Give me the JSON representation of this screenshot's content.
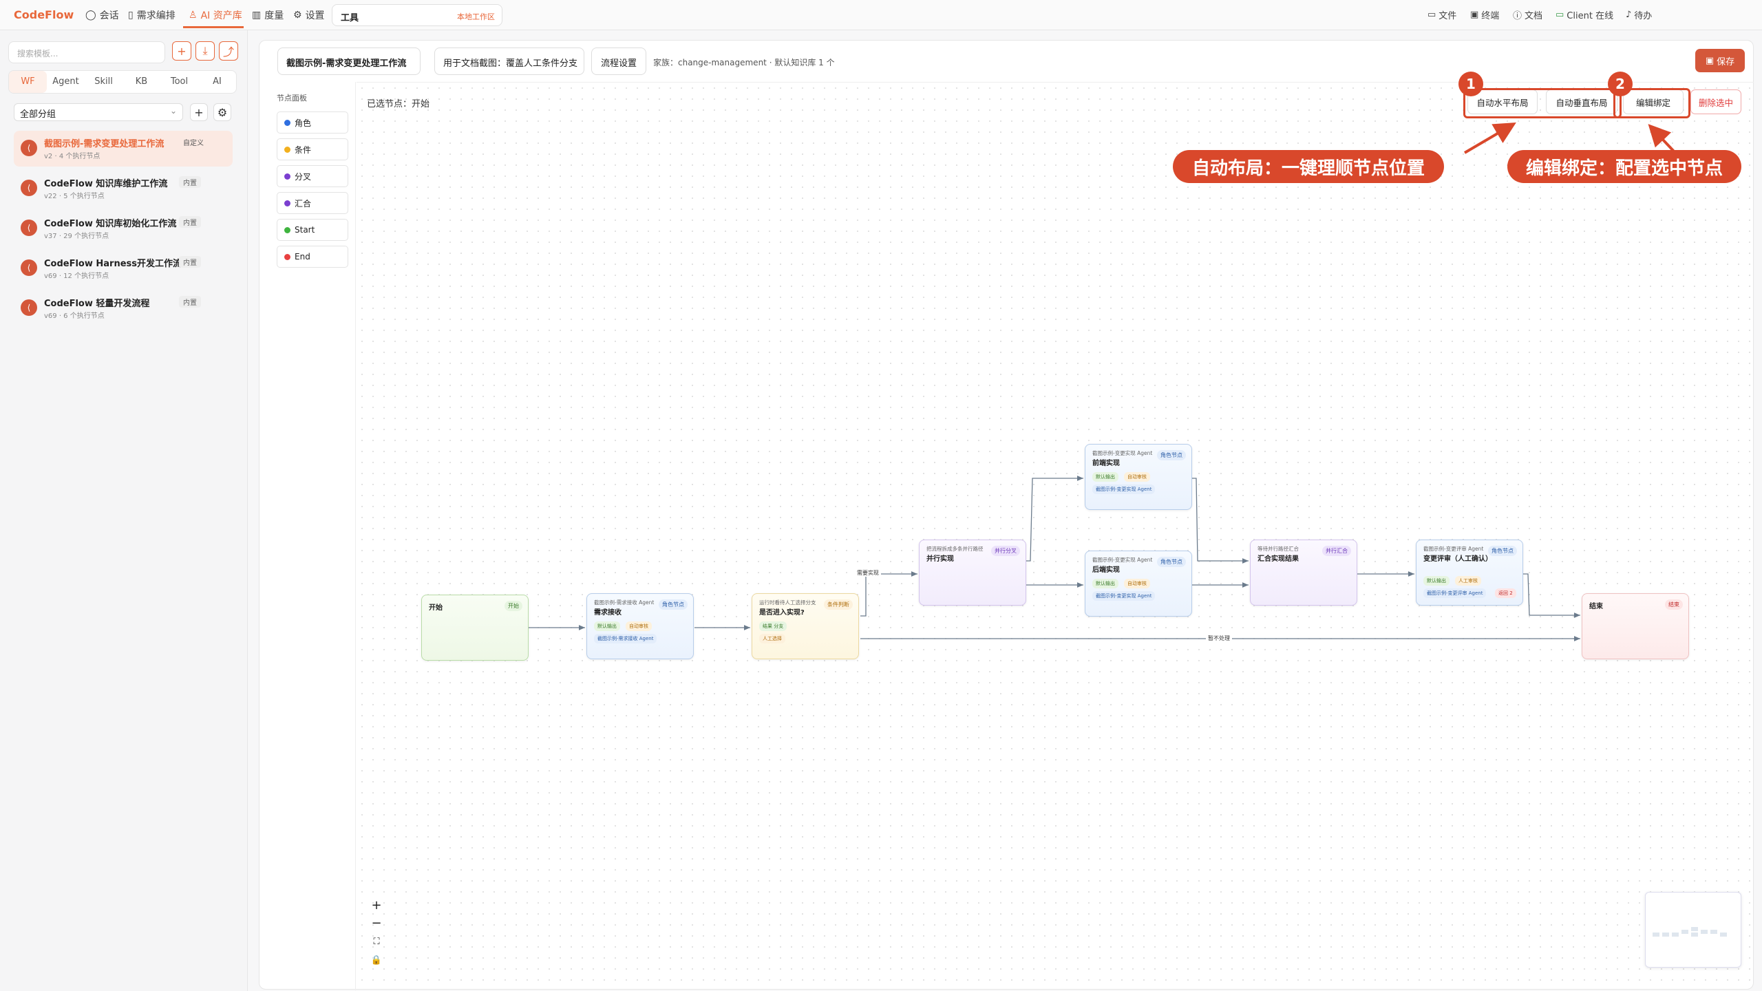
{
  "topbar": {
    "logo": "CodeFlow",
    "nav": [
      {
        "label": "会话",
        "icon": "chat-icon"
      },
      {
        "label": "需求编排",
        "icon": "doc-icon"
      },
      {
        "label": "AI 资产库",
        "icon": "people-icon"
      },
      {
        "label": "度量",
        "icon": "bar-chart-icon"
      },
      {
        "label": "设置",
        "icon": "gear-icon"
      }
    ],
    "tool_input": {
      "value": "工具",
      "workspace": "本地工作区"
    },
    "right": [
      {
        "label": "文件",
        "icon": "folder-icon"
      },
      {
        "label": "终端",
        "icon": "terminal-icon"
      },
      {
        "label": "文档",
        "icon": "help-icon"
      },
      {
        "label": "Client 在线",
        "icon": "monitor-icon"
      },
      {
        "label": "待办",
        "icon": "bell-icon"
      }
    ]
  },
  "sidebar": {
    "search_placeholder": "搜索模板...",
    "tabs": [
      "WF",
      "Agent",
      "Skill",
      "KB",
      "Tool",
      "AI"
    ],
    "group": "全部分组",
    "items": [
      {
        "title": "截图示例-需求变更处理工作流",
        "sub": "v2 · 4 个执行节点",
        "badge": "自定义"
      },
      {
        "title": "CodeFlow 知识库维护工作流",
        "sub": "v22 · 5 个执行节点",
        "badge": "内置"
      },
      {
        "title": "CodeFlow 知识库初始化工作流",
        "sub": "v37 · 29 个执行节点",
        "badge": "内置"
      },
      {
        "title": "CodeFlow Harness开发工作流",
        "sub": "v69 · 12 个执行节点",
        "badge": "内置"
      },
      {
        "title": "CodeFlow 轻量开发流程",
        "sub": "v69 · 6 个执行节点",
        "badge": "内置"
      }
    ]
  },
  "editor": {
    "name": "截图示例-需求变更处理工作流",
    "description": "用于文档截图：覆盖人工条件分支",
    "settings_button": "流程设置",
    "family": "家族：change-management · 默认知识库 1 个",
    "save": "保存",
    "palette_title": "节点面板",
    "palette": [
      {
        "label": "角色",
        "color": "#2f6fe0"
      },
      {
        "label": "条件",
        "color": "#f2b01e"
      },
      {
        "label": "分叉",
        "color": "#7b3fd0"
      },
      {
        "label": "汇合",
        "color": "#7b3fd0"
      },
      {
        "label": "Start",
        "color": "#3fb43f"
      },
      {
        "label": "End",
        "color": "#e84040"
      }
    ],
    "selected": "已选节点：开始",
    "toolbar": {
      "auto_h": "自动水平布局",
      "auto_v": "自动垂直布局",
      "edit_binding": "编辑绑定",
      "delete": "删除选中"
    }
  },
  "annotations": {
    "n1": "1",
    "n2": "2",
    "callout1": "自动布局：一键理顺节点位置",
    "callout2": "编辑绑定：配置选中节点"
  },
  "nodes": {
    "start": {
      "title": "开始",
      "tag": "开始"
    },
    "receive": {
      "sub": "截图示例-需求接收 Agent",
      "title": "需求接收",
      "tag": "角色节点",
      "chips": [
        "默认输出",
        "自动审核",
        "截图示例-需求接收 Agent"
      ]
    },
    "cond": {
      "sub": "运行时看待人工选择分支",
      "title": "是否进入实现?",
      "tag": "条件判断",
      "chips": [
        "结果 分支",
        "人工选择"
      ]
    },
    "fork": {
      "sub": "把流程拆成多条并行路径",
      "title": "并行实现",
      "tag": "并行分叉"
    },
    "front": {
      "sub": "截图示例-变更实现 Agent",
      "title": "前端实现",
      "tag": "角色节点",
      "chips": [
        "默认输出",
        "自动审核",
        "截图示例-变更实现 Agent"
      ]
    },
    "back": {
      "sub": "截图示例-变更实现 Agent",
      "title": "后端实现",
      "tag": "角色节点",
      "chips": [
        "默认输出",
        "自动审核",
        "截图示例-变更实现 Agent"
      ]
    },
    "join": {
      "sub": "等待并行路径汇合",
      "title": "汇合实现结果",
      "tag": "并行汇合"
    },
    "review": {
      "sub": "截图示例-变更评审 Agent",
      "title": "变更评审（人工确认）",
      "tag": "角色节点",
      "chips": [
        "默认输出",
        "人工审核",
        "截图示例-变更评审 Agent",
        "返回 2"
      ]
    },
    "end": {
      "title": "结束",
      "tag": "结束"
    }
  },
  "edges": {
    "need_impl": "需要实现",
    "skip": "暂不处理"
  }
}
